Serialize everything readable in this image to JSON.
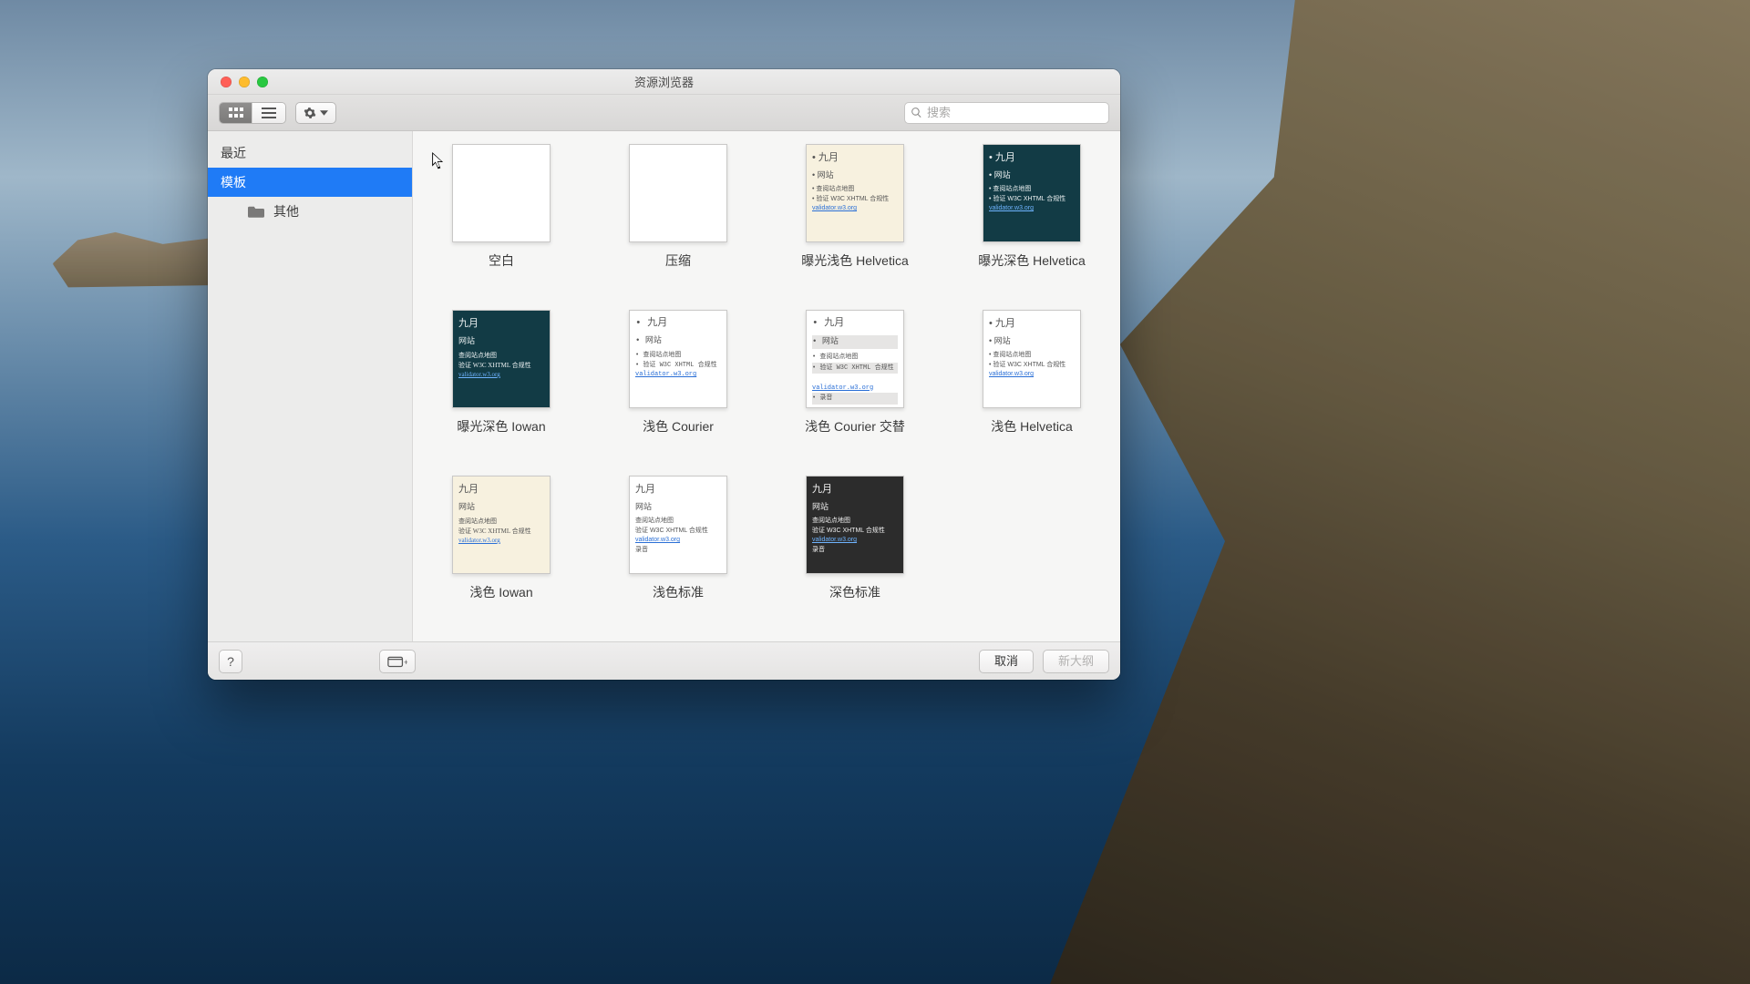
{
  "window": {
    "title": "资源浏览器"
  },
  "toolbar": {
    "search_placeholder": "搜索"
  },
  "sidebar": {
    "recent": "最近",
    "templates": "模板",
    "other": "其他"
  },
  "preview_text": {
    "month": "九月",
    "site": "网站",
    "sitemap": "查阅站点地图",
    "validate": "验证 W3C XHTML 合规性",
    "validator_link": "validator.w3.org",
    "rec": "录音"
  },
  "templates": [
    {
      "label": "空白"
    },
    {
      "label": "压缩"
    },
    {
      "label": "曝光浅色 Helvetica"
    },
    {
      "label": "曝光深色 Helvetica"
    },
    {
      "label": "曝光深色 Iowan"
    },
    {
      "label": "浅色 Courier"
    },
    {
      "label": "浅色 Courier 交替"
    },
    {
      "label": "浅色 Helvetica"
    },
    {
      "label": "浅色 Iowan"
    },
    {
      "label": "浅色标准"
    },
    {
      "label": "深色标准"
    }
  ],
  "footer": {
    "help": "?",
    "cancel": "取消",
    "new_outline": "新大纲"
  }
}
